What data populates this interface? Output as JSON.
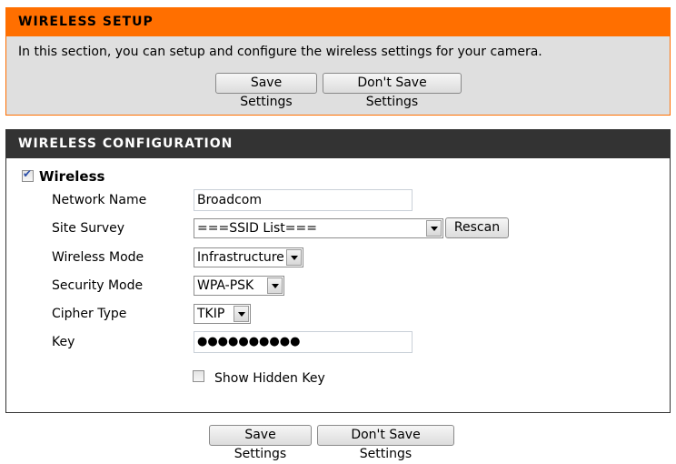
{
  "setup": {
    "title": "WIRELESS SETUP",
    "description": "In this section, you can setup and configure the wireless settings for your camera.",
    "save_label": "Save Settings",
    "dont_save_label": "Don't Save Settings"
  },
  "config": {
    "title": "WIRELESS CONFIGURATION",
    "wireless_label": "Wireless",
    "wireless_enabled": true,
    "fields": {
      "network_name": {
        "label": "Network Name",
        "value": "Broadcom"
      },
      "site_survey": {
        "label": "Site Survey",
        "value": "===SSID List===",
        "rescan_label": "Rescan"
      },
      "wireless_mode": {
        "label": "Wireless Mode",
        "value": "Infrastructure"
      },
      "security_mode": {
        "label": "Security Mode",
        "value": "WPA-PSK"
      },
      "cipher_type": {
        "label": "Cipher Type",
        "value": "TKIP"
      },
      "key": {
        "label": "Key",
        "value": "●●●●●●●●●●"
      }
    },
    "show_hidden_key": {
      "label": "Show Hidden Key",
      "checked": false
    }
  },
  "footer": {
    "save_label": "Save Settings",
    "dont_save_label": "Don't Save Settings"
  }
}
